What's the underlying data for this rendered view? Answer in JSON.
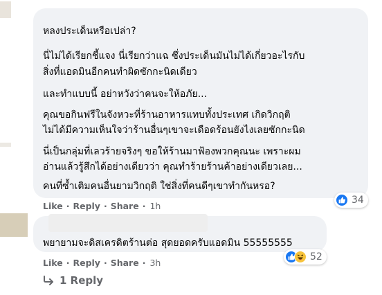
{
  "comments": [
    {
      "lines": [
        "หลงประเด็นหรือเปล่า?",
        "นี่ไม่ได้เรียกชี้แจง นี่เรียกว่าแฉ ซึ่งประเด็นมันไม่ได้เกี่ยวอะไรกับ",
        "สิ่งที่แอดมินอีกคนทำผิดซักกะนิดเดียว",
        "และทำแบบนี้ อย่าหวังว่าคนจะให้อภัย...",
        "คุณขอกินฟรีในจังหวะที่ร้านอาหารแทบทั้งประเทศ เกิดวิกฤติ",
        "ไม่ได้มีความเห็นใจว่าร้านอื่นๆเขาจะเดือดร้อนยังไงเลยซักกะนิด",
        "นี่เป็นกลุ่มที่เลวร้ายจริงๆ ขอให้ร้านมาฟ้องพวกคุณนะ เพราะผม",
        "อ่านแล้วรู้สึกได้อย่างเดียวว่า คุณทำร้ายร้านค้าอย่างเดียวเลย...",
        "คนที่ซ้ำเติมคนอื่นยามวิกฤติ ใช่สิ่งที่คนดีๆเขาทำกันหรอ?"
      ],
      "actions": {
        "like": "Like",
        "reply": "Reply",
        "share": "Share",
        "time": "1h"
      },
      "reactions": {
        "icons": [
          "like-icon"
        ],
        "count": "34"
      }
    },
    {
      "lines": [
        "พยายามจะดิสเครดิตร้านต่อ สุดยอดครับแอดมิน 55555555"
      ],
      "actions": {
        "like": "Like",
        "reply": "Reply",
        "share": "Share",
        "time": "3h"
      },
      "reactions": {
        "icons": [
          "like-icon",
          "haha-icon"
        ],
        "count": "52"
      }
    }
  ],
  "reply_link": {
    "label": "1 Reply",
    "icon": "reply-arrow-icon"
  },
  "colors": {
    "bubble": "#f0f2f5",
    "meta": "#65676b",
    "text": "#050505",
    "like": "#1877f2",
    "haha": "#f7c33b"
  },
  "separator": "·"
}
